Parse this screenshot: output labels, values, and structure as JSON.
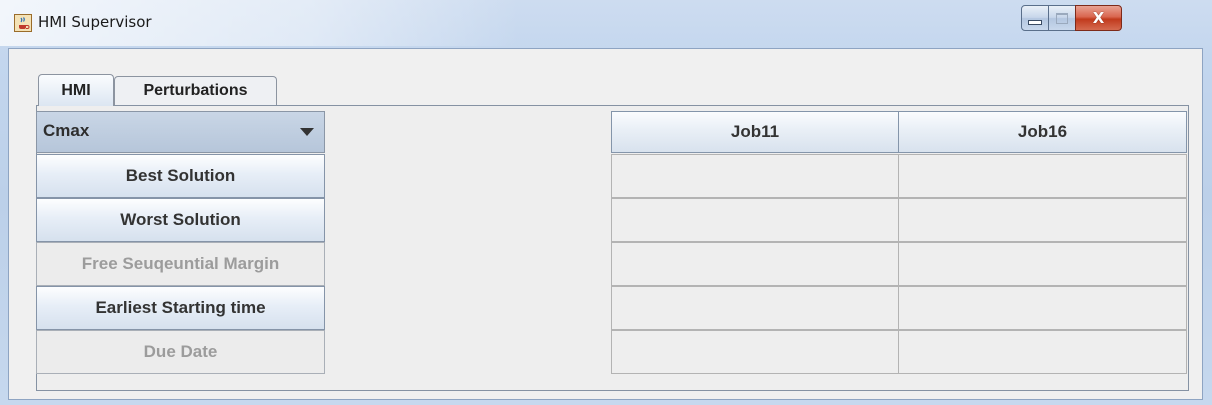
{
  "window": {
    "title": "HMI Supervisor",
    "icon": "java-coffee-icon",
    "controls": {
      "minimize": "minimize-icon",
      "maximize": "maximize-icon",
      "close_glyph": "X"
    }
  },
  "tabs": [
    {
      "label": "HMI",
      "selected": true
    },
    {
      "label": "Perturbations",
      "selected": false
    }
  ],
  "criteria_select": {
    "value": "Cmax",
    "icon": "chevron-down-icon"
  },
  "buttons": [
    {
      "label": "Best Solution",
      "enabled": true
    },
    {
      "label": "Worst Solution",
      "enabled": true
    },
    {
      "label": "Free Seuqeuntial Margin",
      "enabled": false
    },
    {
      "label": "Earliest Starting time",
      "enabled": true
    },
    {
      "label": "Due Date",
      "enabled": false
    }
  ],
  "table": {
    "columns": [
      "Job11",
      "Job16"
    ],
    "rows": [
      [
        "",
        ""
      ],
      [
        "",
        ""
      ],
      [
        "",
        ""
      ],
      [
        "",
        ""
      ],
      [
        "",
        ""
      ]
    ]
  },
  "colors": {
    "accent": "#d6e1ee",
    "disabled_text": "#9c9c9c",
    "close_button": "#c13a1d"
  }
}
